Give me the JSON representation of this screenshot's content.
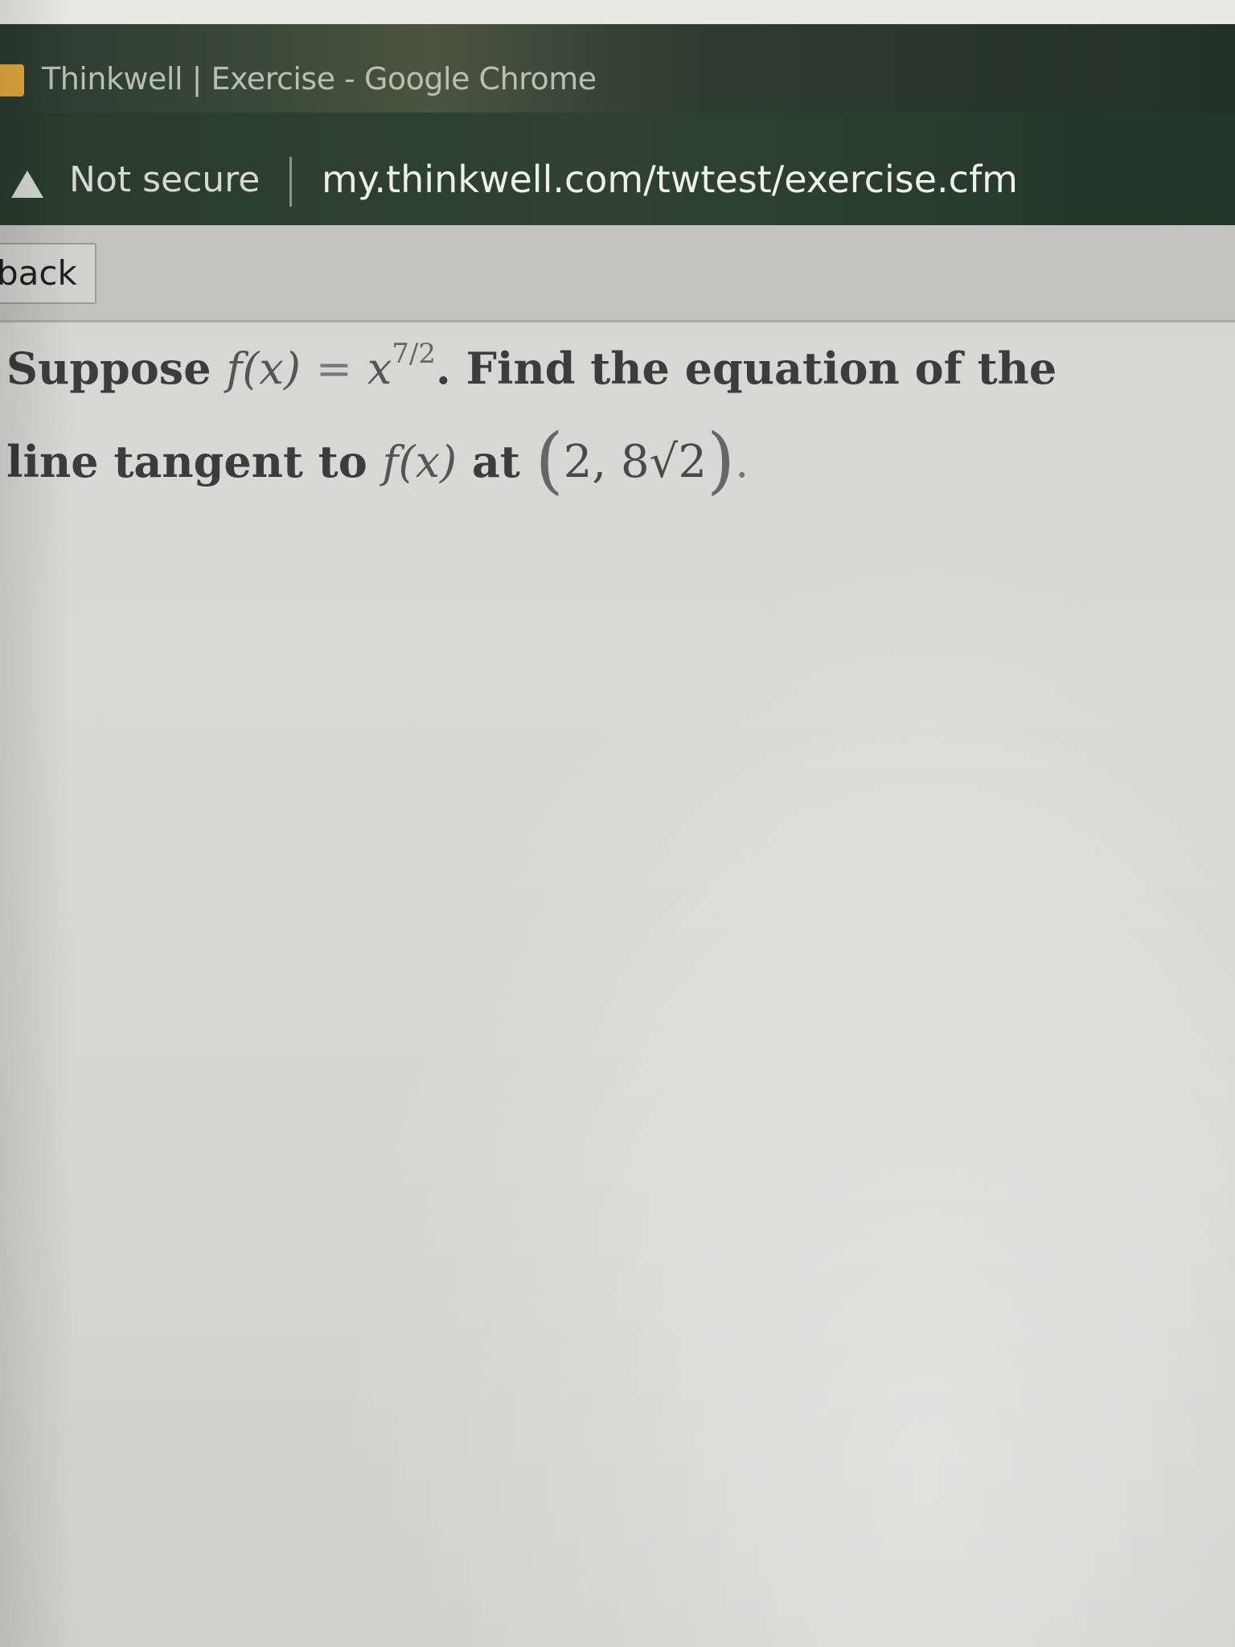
{
  "window": {
    "title": "Thinkwell | Exercise - Google Chrome"
  },
  "address_bar": {
    "security_label": "Not secure",
    "url": "my.thinkwell.com/twtest/exercise.cfm"
  },
  "toolbar": {
    "back_label": "back"
  },
  "question": {
    "line1": {
      "word_suppose": "Suppose",
      "func": "f(x)",
      "equals": "=",
      "base": "x",
      "exponent": "7/2",
      "period": ".",
      "rest": "Find the equation of the"
    },
    "line2": {
      "lead": "line tangent to",
      "func": "f(x)",
      "at": "at",
      "open_paren": "(",
      "point": "2, 8√2",
      "close_paren": ")",
      "end": "."
    }
  },
  "colors": {
    "titlebar_bg": "#2f3d30",
    "page_bg": "#d6d6d4",
    "text": "#3c3c3c"
  },
  "icons": {
    "favicon": "thinkwell-favicon-icon",
    "security": "warning-triangle-icon"
  }
}
